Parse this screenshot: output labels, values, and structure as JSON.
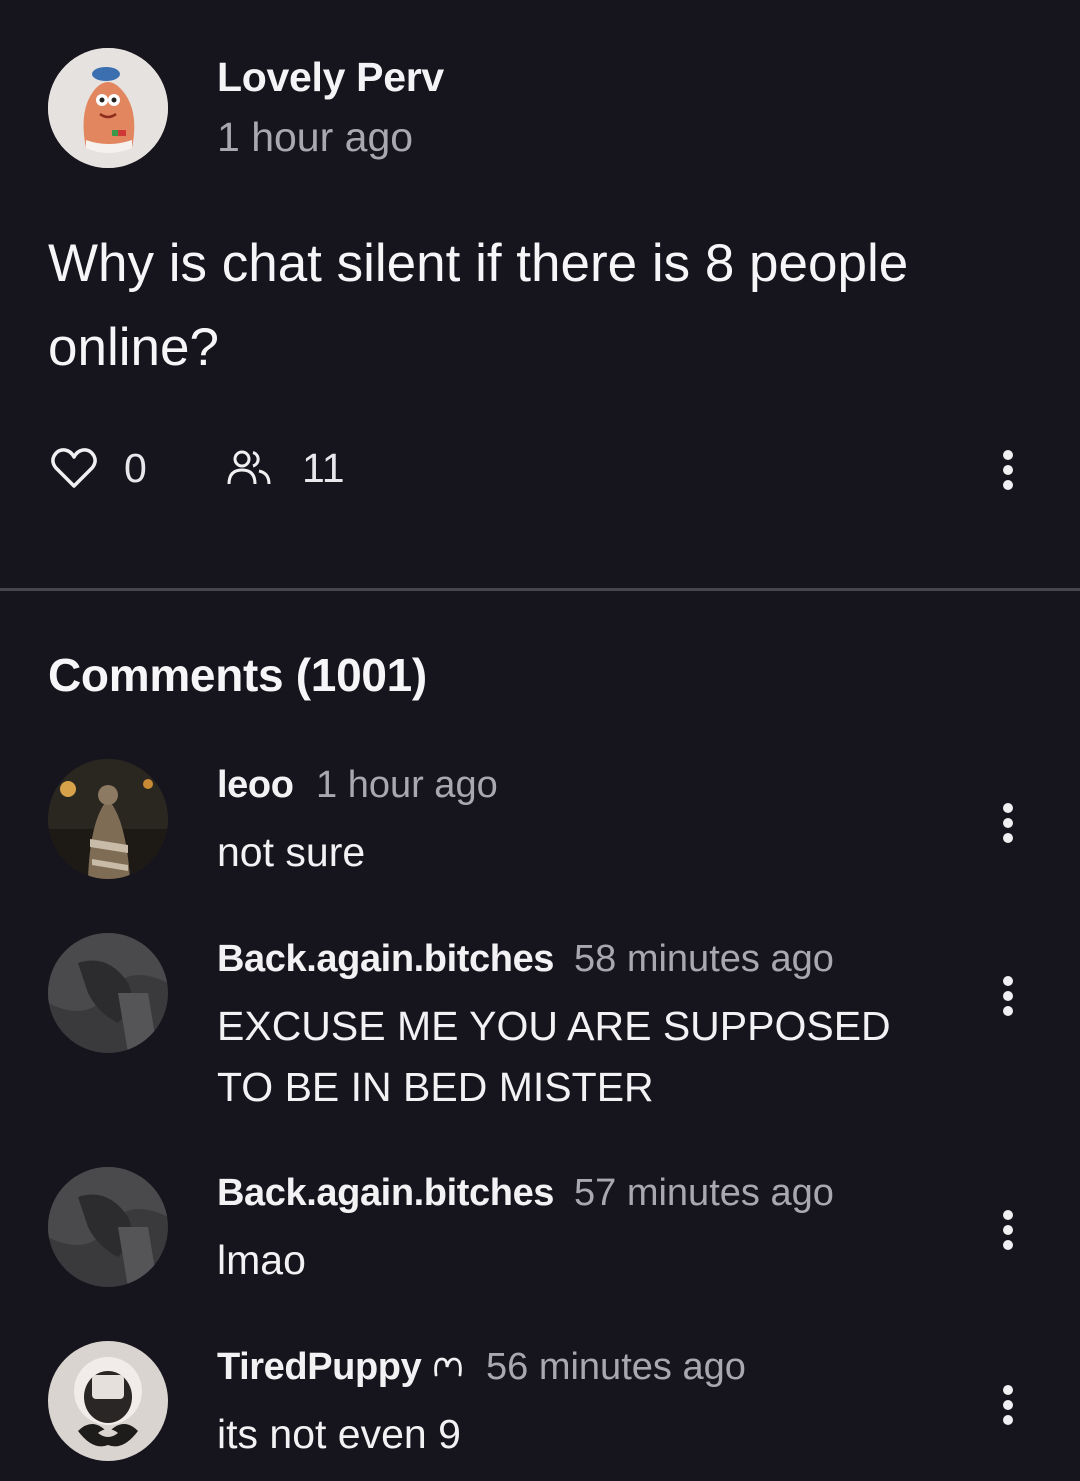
{
  "post": {
    "author": "Lovely Perv",
    "time": "1 hour ago",
    "body": "Why is chat silent if there is 8 people online?",
    "likes": "0",
    "participants": "11"
  },
  "comments_heading": "Comments (1001)",
  "comments": [
    {
      "author": "leoo",
      "time": "1 hour ago",
      "text": "not sure"
    },
    {
      "author": "Back.again.bitches",
      "time": "58 minutes ago",
      "text": "EXCUSE ME YOU ARE SUPPOSED TO BE IN BED MISTER"
    },
    {
      "author": "Back.again.bitches",
      "time": "57 minutes ago",
      "text": "lmao"
    },
    {
      "author": "TiredPuppy",
      "time": "56 minutes ago",
      "text": "its not even 9"
    }
  ],
  "icons": {
    "like": "heart-outline-icon",
    "participants": "people-icon",
    "more": "more-vertical-icon",
    "badge": "crown-outline-icon"
  },
  "colors": {
    "background": "#16151d",
    "text_primary": "#f2f2f4",
    "text_secondary": "#a9a8b0",
    "divider": "#46454e"
  }
}
